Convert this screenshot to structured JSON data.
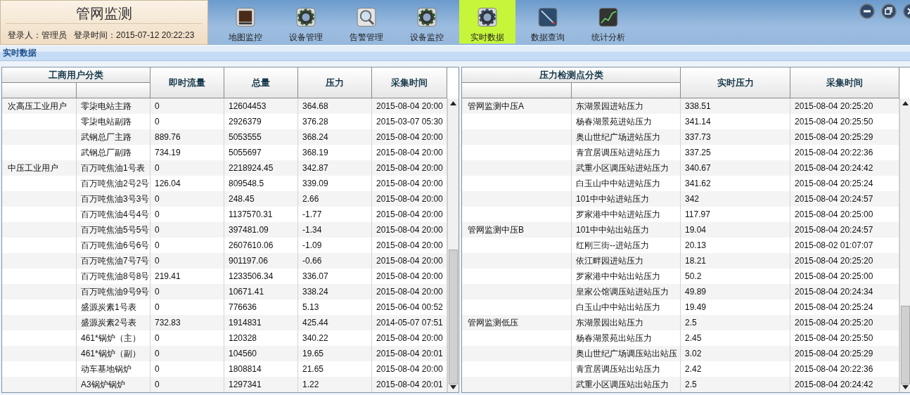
{
  "header": {
    "title": "管网监测",
    "user": "登录人：管理员",
    "login_time": "登录时间：2015-07-12 20:22:23"
  },
  "nav": [
    {
      "label": "地图监控",
      "selected": false
    },
    {
      "label": "设备管理",
      "selected": false
    },
    {
      "label": "告警管理",
      "selected": false
    },
    {
      "label": "设备监控",
      "selected": false
    },
    {
      "label": "实时数据",
      "selected": true
    },
    {
      "label": "数据查询",
      "selected": false
    },
    {
      "label": "统计分析",
      "selected": false
    }
  ],
  "breadcrumb": "实时数据",
  "left_table": {
    "columns": [
      "工商用户分类",
      "",
      "即时流量",
      "总量",
      "压力",
      "采集时间"
    ],
    "rows": [
      {
        "cells": [
          "次高压工业用户",
          "零柒电站主路",
          "0",
          "12604453",
          "364.68",
          "2015-08-04 20:00"
        ]
      },
      {
        "cells": [
          "",
          "零柒电站副路",
          "0",
          "2926379",
          "376.28",
          "2015-03-07 05:30"
        ]
      },
      {
        "cells": [
          "",
          "武钢总厂主路",
          "889.76",
          "5053555",
          "368.24",
          "2015-08-04 20:00"
        ]
      },
      {
        "cells": [
          "",
          "武钢总厂副路",
          "734.19",
          "5055697",
          "368.19",
          "2015-08-04 20:00"
        ]
      },
      {
        "cells": [
          "中压工业用户",
          "百万吨焦油1号表",
          "0",
          "2218924.45",
          "342.87",
          "2015-08-04 20:00"
        ]
      },
      {
        "cells": [
          "",
          "百万吨焦油2号2号",
          "126.04",
          "809548.5",
          "339.09",
          "2015-08-04 20:00"
        ]
      },
      {
        "cells": [
          "",
          "百万吨焦油3号3号",
          "0",
          "248.45",
          "2.66",
          "2015-08-04 20:00"
        ]
      },
      {
        "cells": [
          "",
          "百万吨焦油4号4号",
          "0",
          "1137570.31",
          "-1.77",
          "2015-08-04 20:00"
        ]
      },
      {
        "cells": [
          "",
          "百万吨焦油5号5号",
          "0",
          "397481.09",
          "-1.34",
          "2015-08-04 20:00"
        ]
      },
      {
        "cells": [
          "",
          "百万吨焦油6号6号",
          "0",
          "2607610.06",
          "-1.09",
          "2015-08-04 20:00"
        ]
      },
      {
        "cells": [
          "",
          "百万吨焦油7号7号",
          "0",
          "901197.06",
          "-0.66",
          "2015-08-04 20:00"
        ]
      },
      {
        "cells": [
          "",
          "百万吨焦油8号8号",
          "219.41",
          "1233506.34",
          "336.07",
          "2015-08-04 20:00"
        ]
      },
      {
        "cells": [
          "",
          "百万吨焦油9号9号",
          "0",
          "10671.41",
          "338.24",
          "2015-08-04 20:00"
        ]
      },
      {
        "cells": [
          "",
          "盛源炭素1号表",
          "0",
          "776636",
          "5.13",
          "2015-06-04 00:52"
        ]
      },
      {
        "cells": [
          "",
          "盛源炭素2号表",
          "732.83",
          "1914831",
          "425.44",
          "2014-05-07 07:51"
        ]
      },
      {
        "cells": [
          "",
          "461*锅炉（主）",
          "0",
          "120328",
          "340.22",
          "2015-08-04 20:00"
        ]
      },
      {
        "cells": [
          "",
          "461*锅炉（副）",
          "0",
          "104560",
          "19.65",
          "2015-08-04 20:01"
        ]
      },
      {
        "cells": [
          "",
          "动车基地锅炉",
          "0",
          "1808814",
          "21.65",
          "2015-08-04 20:00"
        ]
      },
      {
        "cells": [
          "",
          "A3锅炉锅炉",
          "0",
          "1297341",
          "1.22",
          "2015-08-04 20:01"
        ]
      }
    ]
  },
  "right_table": {
    "columns": [
      "压力检测点分类",
      "",
      "实时压力",
      "采集时间"
    ],
    "rows": [
      {
        "cells": [
          "管网监测中压A",
          "东湖景园进站压力",
          "338.51",
          "2015-08-04 20:25:20"
        ]
      },
      {
        "cells": [
          "",
          "杨春湖景苑进站压力",
          "341.14",
          "2015-08-04 20:25:50"
        ]
      },
      {
        "cells": [
          "",
          "奥山世纪广场进站压力",
          "337.73",
          "2015-08-04 20:25:29"
        ]
      },
      {
        "cells": [
          "",
          "青宜居调压站进站压力",
          "337.25",
          "2015-08-04 20:22:36"
        ]
      },
      {
        "cells": [
          "",
          "武重小区调压站进站压力",
          "340.67",
          "2015-08-04 20:24:42"
        ]
      },
      {
        "cells": [
          "",
          "白玉山中中站进站压力",
          "341.62",
          "2015-08-04 20:25:24"
        ]
      },
      {
        "cells": [
          "",
          "101中中站进站压力",
          "342",
          "2015-08-04 20:24:57"
        ]
      },
      {
        "cells": [
          "",
          "罗家港中中站进站压力",
          "117.97",
          "2015-08-04 20:25:00"
        ]
      },
      {
        "cells": [
          "管网监测中压B",
          "101中中站出站压力",
          "19.04",
          "2015-08-04 20:24:57"
        ]
      },
      {
        "cells": [
          "",
          "红刚三街--进站压力",
          "20.13",
          "2015-08-02 01:07:07"
        ]
      },
      {
        "cells": [
          "",
          "依江畔园进站压力",
          "18.21",
          "2015-08-04 20:25:20"
        ]
      },
      {
        "cells": [
          "",
          "罗家港中中站出站压力",
          "50.2",
          "2015-08-04 20:25:00"
        ]
      },
      {
        "cells": [
          "",
          "皇家公馆调压站进站压力",
          "49.89",
          "2015-08-04 20:24:34"
        ]
      },
      {
        "cells": [
          "",
          "白玉山中中站出站压力",
          "19.49",
          "2015-08-04 20:25:24"
        ]
      },
      {
        "cells": [
          "管网监测低压",
          "东湖景园出站压力",
          "2.5",
          "2015-08-04 20:25:20"
        ]
      },
      {
        "cells": [
          "",
          "杨春湖景苑出站压力",
          "2.45",
          "2015-08-04 20:25:50"
        ]
      },
      {
        "cells": [
          "",
          "奥山世纪广场调压站出站压",
          "3.02",
          "2015-08-04 20:25:29"
        ]
      },
      {
        "cells": [
          "",
          "青宜居调压站出站压力",
          "2.42",
          "2015-08-04 20:22:36"
        ]
      },
      {
        "cells": [
          "",
          "武重小区调压站出站压力",
          "2.5",
          "2015-08-04 20:24:42"
        ]
      }
    ]
  }
}
